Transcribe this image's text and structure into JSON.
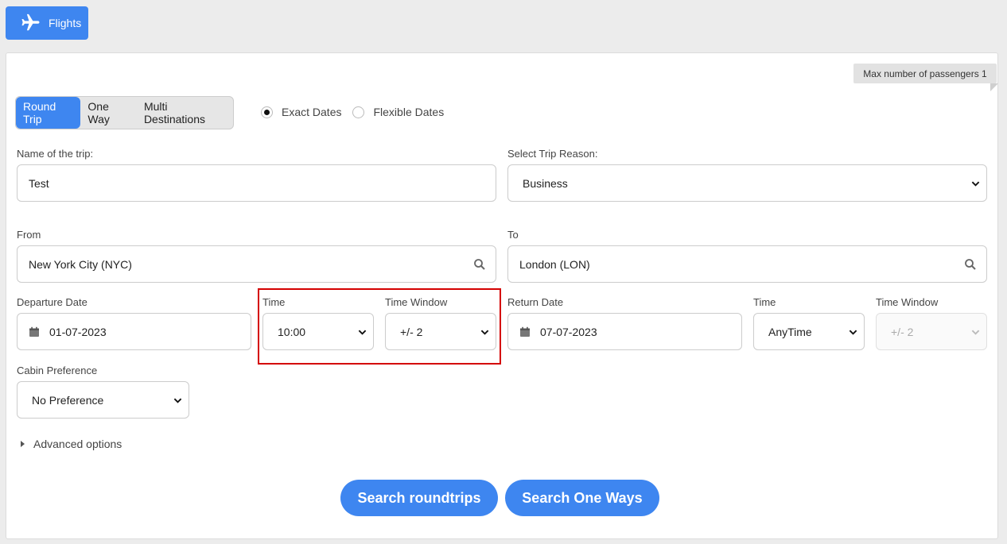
{
  "tab": {
    "label": "Flights",
    "icon": "airplane-icon"
  },
  "badge": {
    "text": "Max number of passengers 1"
  },
  "trip_types": [
    {
      "label": "Round Trip",
      "active": true
    },
    {
      "label": "One Way",
      "active": false
    },
    {
      "label": "Multi Destinations",
      "active": false
    }
  ],
  "date_mode": [
    {
      "label": "Exact Dates",
      "checked": true
    },
    {
      "label": "Flexible Dates",
      "checked": false
    }
  ],
  "form": {
    "trip_name": {
      "label": "Name of the trip:",
      "value": "Test"
    },
    "trip_reason": {
      "label": "Select Trip Reason:",
      "value": "Business"
    },
    "from": {
      "label": "From",
      "value": "New York City (NYC)"
    },
    "to": {
      "label": "To",
      "value": "London (LON)"
    },
    "departure_date": {
      "label": "Departure Date",
      "value": "01-07-2023"
    },
    "departure_time": {
      "label": "Time",
      "value": "10:00"
    },
    "departure_window": {
      "label": "Time Window",
      "value": "+/- 2"
    },
    "return_date": {
      "label": "Return Date",
      "value": "07-07-2023"
    },
    "return_time": {
      "label": "Time",
      "value": "AnyTime"
    },
    "return_window": {
      "label": "Time Window",
      "value": "+/- 2",
      "disabled": true
    },
    "cabin": {
      "label": "Cabin Preference",
      "value": "No Preference"
    }
  },
  "advanced": {
    "label": "Advanced options"
  },
  "buttons": {
    "search_roundtrips": "Search roundtrips",
    "search_one_ways": "Search One Ways"
  },
  "colors": {
    "accent": "#3e86f0",
    "highlight": "#d40000"
  }
}
